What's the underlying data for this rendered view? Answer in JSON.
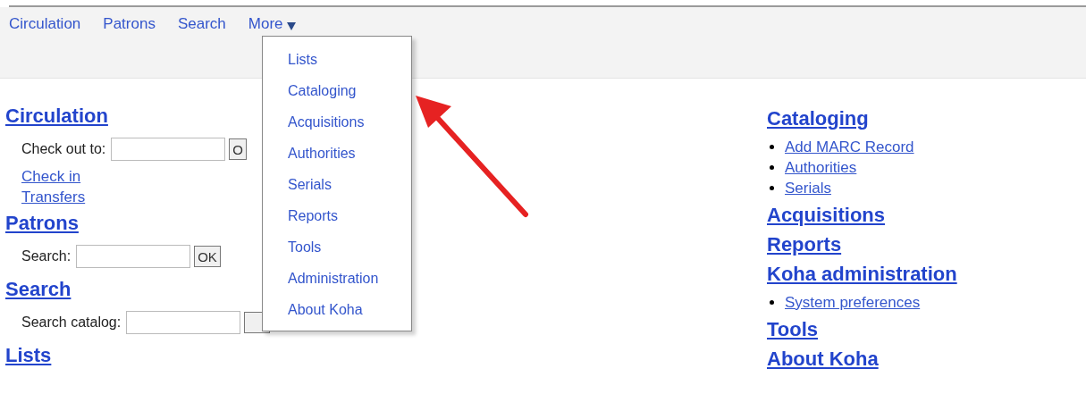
{
  "nav": {
    "items": [
      {
        "label": "Circulation"
      },
      {
        "label": "Patrons"
      },
      {
        "label": "Search"
      }
    ],
    "more": {
      "label": "More",
      "expanded": true,
      "items": [
        "Lists",
        "Cataloging",
        "Acquisitions",
        "Authorities",
        "Serials",
        "Reports",
        "Tools",
        "Administration",
        "About Koha"
      ]
    }
  },
  "left_column": [
    {
      "heading": "Circulation",
      "fields": [
        {
          "label": "Check out to:",
          "button": "O"
        }
      ],
      "links": [
        "Check in",
        "Transfers"
      ]
    },
    {
      "heading": "Patrons",
      "fields": [
        {
          "label": "Search:",
          "button": "OK"
        }
      ]
    },
    {
      "heading": "Search",
      "fields": [
        {
          "label": "Search catalog:"
        }
      ]
    },
    {
      "heading": "Lists"
    }
  ],
  "right_column": [
    {
      "heading": "Cataloging",
      "links": [
        "Add MARC Record",
        "Authorities",
        "Serials"
      ]
    },
    {
      "heading": "Acquisitions"
    },
    {
      "heading": "Reports"
    },
    {
      "heading": "Koha administration",
      "links": [
        "System preferences"
      ]
    },
    {
      "heading": "Tools"
    },
    {
      "heading": "About Koha"
    }
  ]
}
